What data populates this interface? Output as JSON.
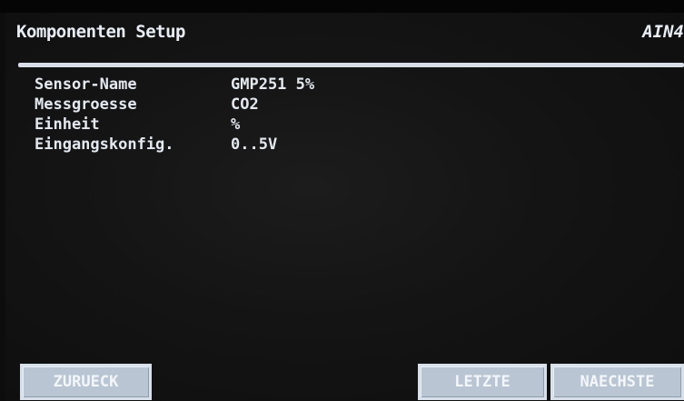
{
  "header": {
    "title": "Komponenten Setup",
    "right_text": "AIN4"
  },
  "params": [
    {
      "label": "Sensor-Name",
      "value": "GMP251 5%"
    },
    {
      "label": "Messgroesse",
      "value": "CO2"
    },
    {
      "label": "Einheit",
      "value": "%"
    },
    {
      "label": "Eingangskonfig.",
      "value": "0..5V"
    }
  ],
  "buttons": {
    "back": "ZURUECK",
    "last": "LETZTE",
    "next": "NAECHSTE"
  },
  "colors": {
    "background": "#141414",
    "text": "#e4e9f1",
    "button": "#b9c5d3"
  }
}
